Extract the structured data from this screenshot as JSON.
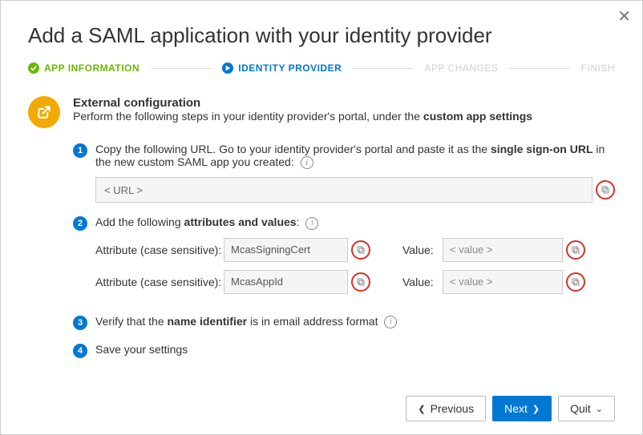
{
  "dialog": {
    "title": "Add a SAML application with your identity provider"
  },
  "stepper": {
    "app_info": "APP INFORMATION",
    "identity_provider": "IDENTITY PROVIDER",
    "app_changes": "APP CHANGES",
    "finish": "FINISH"
  },
  "section": {
    "title": "External configuration",
    "desc_pre": "Perform the following steps in your identity provider's portal, under the ",
    "desc_bold": "custom app settings"
  },
  "step1": {
    "text_pre": "Copy the following URL. Go to your identity provider's portal and paste it as the ",
    "text_bold": "single sign-on URL",
    "text_post": " in the new custom SAML app you created:",
    "url_value": "< URL >"
  },
  "step2": {
    "text_pre": "Add the following ",
    "text_bold": "attributes and values",
    "text_post": ":",
    "attr_label": "Attribute (case sensitive):",
    "val_label": "Value:",
    "rows": [
      {
        "attr": "McasSigningCert",
        "val": "< value >"
      },
      {
        "attr": "McasAppId",
        "val": "< value >"
      }
    ]
  },
  "step3": {
    "text_pre": "Verify that the ",
    "text_bold": "name identifier",
    "text_post": " is in email address format"
  },
  "step4": {
    "text": "Save your settings"
  },
  "footer": {
    "previous": "Previous",
    "next": "Next",
    "quit": "Quit"
  }
}
